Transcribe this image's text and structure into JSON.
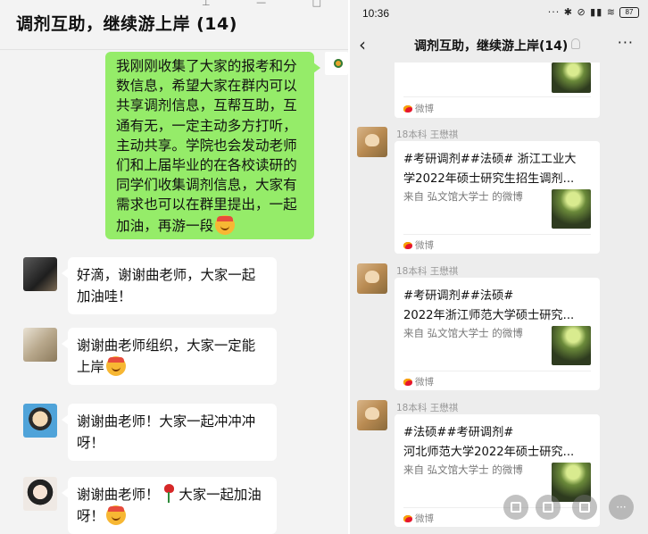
{
  "left": {
    "title": "调剂互助，继续游上岸 (14)",
    "messages": [
      {
        "text": "我刚刚收集了大家的报考和分数信息，希望大家在群内可以共享调剂信息，互帮互助，互通有无，一定主动多方打听，主动共享。学院也会发动老师们和上届毕业的在各校读研的同学们收集调剂信息，大家有需求也可以在群里提出，一起加油，再游一段",
        "emoji": "emoji-cheer"
      },
      {
        "text_line1": "好滴，谢谢曲老师，大家一起",
        "text_line2": "加油哇！"
      },
      {
        "text_line1": "谢谢曲老师组织，大家一定能",
        "text_line2": "上岸",
        "emoji": "emoji-cheer"
      },
      {
        "text_line1": "谢谢曲老师！大家一起冲冲冲",
        "text_line2": "呀！"
      },
      {
        "text_line1a": "谢谢曲老师！",
        "text_line1b": "大家一起加油",
        "text_line2": "呀！",
        "emoji": "emoji-cheer",
        "icon": "rose"
      }
    ]
  },
  "right": {
    "status_time": "10:36",
    "battery": "87",
    "nav_title": "调剂互助，继续游上岸(14)",
    "cards": [
      {
        "footer": "微博"
      },
      {
        "sender": "18本科 王懋祺",
        "title": "#考研调剂##法硕# 浙江工业大\n学2022年硕士研究生招生调剂...",
        "source": "来自 弘文馆大学士 的微博",
        "footer": "微博"
      },
      {
        "sender": "18本科 王懋祺",
        "title": "#考研调剂##法硕#\n2022年浙江师范大学硕士研究...",
        "source": "来自 弘文馆大学士 的微博",
        "footer": "微博"
      },
      {
        "sender": "18本科 王懋祺",
        "title": "#法硕##考研调剂#\n河北师范大学2022年硕士研究...",
        "source": "来自 弘文馆大学士 的微博",
        "footer": "微博"
      }
    ]
  }
}
